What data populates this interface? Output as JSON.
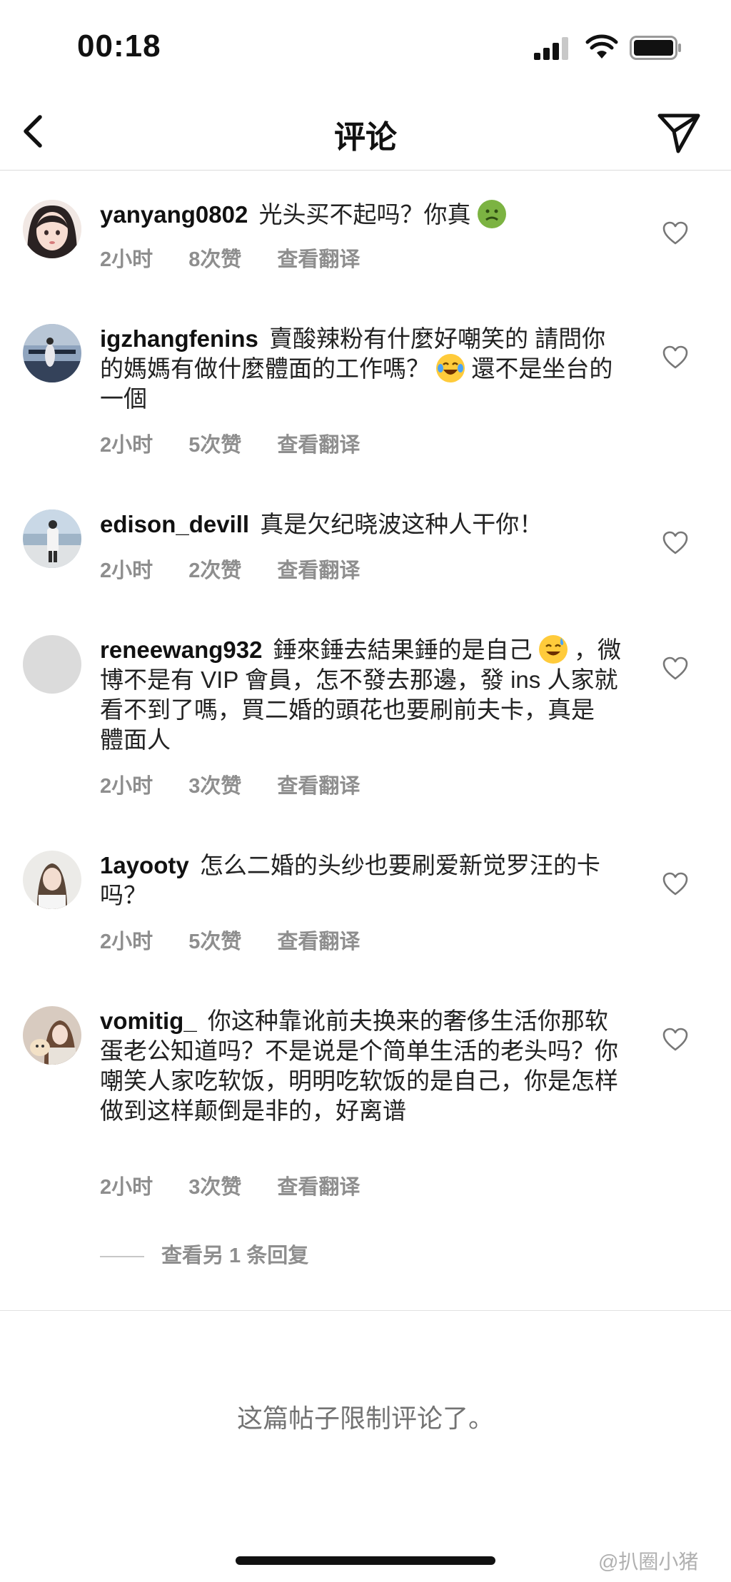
{
  "status_bar": {
    "time": "00:18"
  },
  "header": {
    "title": "评论"
  },
  "comments": [
    {
      "username": "yanyang0802",
      "text": "光头买不起吗？你真",
      "emoji": "nauseated-face-emoji",
      "time": "2小时",
      "likes": "8次赞",
      "translate": "查看翻译"
    },
    {
      "username": "igzhangfenins",
      "text": "賣酸辣粉有什麼好嘲笑的 請問你的媽媽有做什麼體面的工作嗎？",
      "emoji": "tears-of-joy-emoji",
      "text_after": "還不是坐台的一個",
      "time": "2小时",
      "likes": "5次赞",
      "translate": "查看翻译"
    },
    {
      "username": "edison_devill",
      "text": "真是欠纪晓波这种人干你！",
      "time": "2小时",
      "likes": "2次赞",
      "translate": "查看翻译"
    },
    {
      "username": "reneewang932",
      "text": "錘來錘去結果錘的是自己",
      "emoji": "sweat-smile-emoji",
      "text_after": "，微博不是有 VIP 會員，怎不發去那邊，發 ins 人家就看不到了嗎，買二婚的頭花也要刷前夫卡，真是 體面人",
      "time": "2小时",
      "likes": "3次赞",
      "translate": "查看翻译"
    },
    {
      "username": "1ayooty",
      "text": "怎么二婚的头纱也要刷爱新觉罗汪的卡吗？",
      "time": "2小时",
      "likes": "5次赞",
      "translate": "查看翻译"
    },
    {
      "username": "vomitig_",
      "text": "你这种靠讹前夫换来的奢侈生活你那软蛋老公知道吗？不是说是个简单生活的老头吗？你嘲笑人家吃软饭，明明吃软饭的是自己，你是怎样做到这样颠倒是非的，好离谱",
      "time": "2小时",
      "likes": "3次赞",
      "translate": "查看翻译"
    }
  ],
  "view_replies": "查看另 1 条回复",
  "footer": {
    "restricted_notice": "这篇帖子限制评论了。",
    "watermark": "@扒圈小猪"
  },
  "colors": {
    "meta_gray": "#8e8e8e",
    "text": "#111111",
    "divider": "#dcdcdc"
  }
}
